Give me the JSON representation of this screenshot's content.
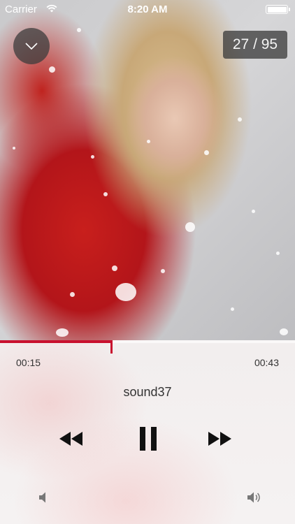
{
  "status_bar": {
    "carrier": "Carrier",
    "time": "8:20 AM",
    "icons": [
      "wifi-icon",
      "battery-icon"
    ]
  },
  "artwork": {
    "description_icon": "album-artwork"
  },
  "header": {
    "collapse_icon": "chevron-down-icon",
    "track_counter": "27 / 95"
  },
  "player": {
    "elapsed": "00:15",
    "total": "00:43",
    "progress_fraction": 0.38,
    "title": "sound37",
    "controls": [
      "rewind-icon",
      "pause-icon",
      "fast-forward-icon"
    ],
    "volume_icons": [
      "volume-low-icon",
      "volume-high-icon"
    ]
  },
  "colors": {
    "accent": "#c8102e",
    "text": "#333333",
    "overlay": "#3c3c3c"
  }
}
